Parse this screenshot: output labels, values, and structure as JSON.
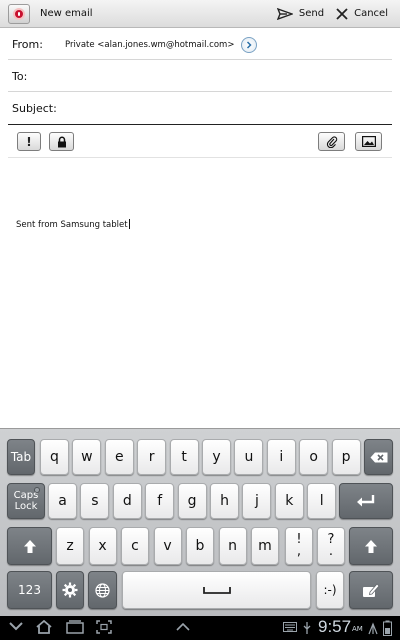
{
  "actionbar": {
    "title": "New email",
    "send_label": "Send",
    "cancel_label": "Cancel"
  },
  "compose": {
    "from_label": "From:",
    "from_value": "Private <alan.jones.wm@hotmail.com>",
    "to_label": "To:",
    "to_value": "",
    "subject_label": "Subject:",
    "subject_value": "",
    "body": "Sent from Samsung tablet"
  },
  "toolbar": {
    "priority_label": "!",
    "buttons": [
      "priority",
      "security",
      "attach",
      "insert-image"
    ]
  },
  "keyboard": {
    "row1": [
      "q",
      "w",
      "e",
      "r",
      "t",
      "y",
      "u",
      "i",
      "o",
      "p"
    ],
    "row2": [
      "a",
      "s",
      "d",
      "f",
      "g",
      "h",
      "j",
      "k",
      "l"
    ],
    "row3": [
      "z",
      "x",
      "c",
      "v",
      "b",
      "n",
      "m"
    ],
    "tab_label": "Tab",
    "caps_label_1": "Caps",
    "caps_label_2": "Lock",
    "num_label": "123",
    "emoticon_label": ":-)",
    "excl_top": "!",
    "excl_bottom": ",",
    "quest_top": "?",
    "quest_bottom": "."
  },
  "statusbar": {
    "time": "9:57",
    "ampm": "AM"
  },
  "colors": {
    "accent_red": "#c8102e",
    "key_dark": "#6a6f74",
    "key_light": "#ffffff",
    "clock": "#cfd8e0"
  }
}
